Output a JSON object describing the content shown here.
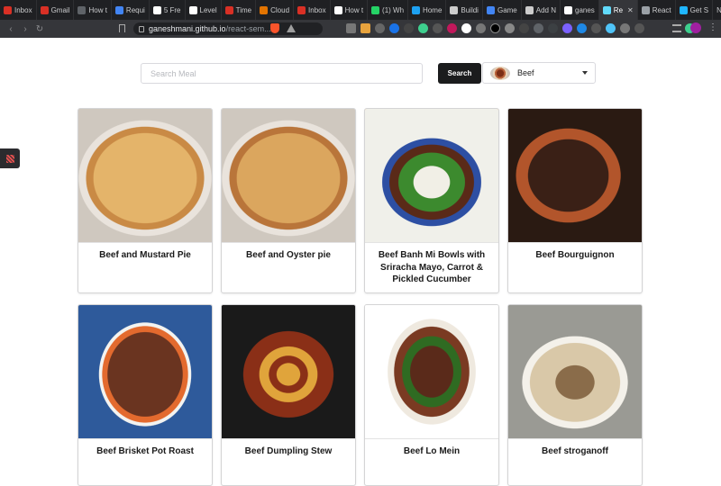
{
  "browser": {
    "tabs": [
      {
        "label": "Inbox",
        "color": "#d93025"
      },
      {
        "label": "Gmail",
        "color": "#d93025"
      },
      {
        "label": "How t",
        "color": "#5f6368"
      },
      {
        "label": "Requi",
        "color": "#4285f4"
      },
      {
        "label": "5 Fre",
        "color": "#ffffff"
      },
      {
        "label": "Level",
        "color": "#ffffff"
      },
      {
        "label": "Time",
        "color": "#d93025"
      },
      {
        "label": "Cloud",
        "color": "#e37400"
      },
      {
        "label": "Inbox",
        "color": "#d93025"
      },
      {
        "label": "How t",
        "color": "#ffffff"
      },
      {
        "label": "(1) Wh",
        "color": "#25d366"
      },
      {
        "label": "Home",
        "color": "#1da1f2"
      },
      {
        "label": "Buildi",
        "color": "#cccccc"
      },
      {
        "label": "Game",
        "color": "#4285f4"
      },
      {
        "label": "Add N",
        "color": "#cccccc"
      },
      {
        "label": "ganes",
        "color": "#ffffff"
      },
      {
        "label": "Re",
        "color": "#61dafb",
        "active": true
      },
      {
        "label": "React",
        "color": "#9aa0a6"
      },
      {
        "label": "Get S",
        "color": "#1fb6ff"
      },
      {
        "label": "New Tab",
        "color": ""
      }
    ],
    "url_host": "ganeshmani.github.io",
    "url_path": "/react-sem..."
  },
  "search": {
    "placeholder": "Search Meal",
    "value": "",
    "button_label": "Search"
  },
  "category": {
    "selected": "Beef"
  },
  "meals": [
    {
      "title": "Beef and Mustard Pie",
      "image": "pie-image",
      "colors": [
        "#c98a45",
        "#e4b46a",
        "#5a2a18"
      ]
    },
    {
      "title": "Beef and Oyster pie",
      "image": "pie-image",
      "colors": [
        "#b9753a",
        "#dba65e",
        "#3c2012"
      ]
    },
    {
      "title": "Beef Banh Mi Bowls with Sriracha Mayo, Carrot & Pickled Cucumber",
      "image": "bowl-image",
      "colors": [
        "#e9a24a",
        "#3c8a2e",
        "#f1efe6"
      ]
    },
    {
      "title": "Beef Bourguignon",
      "image": "stew-image",
      "colors": [
        "#3a2016",
        "#b2552b",
        "#6d3a22"
      ]
    },
    {
      "title": "Beef Brisket Pot Roast",
      "image": "roast-image",
      "colors": [
        "#6a3420",
        "#2e5a9b",
        "#e36a2e"
      ]
    },
    {
      "title": "Beef Dumpling Stew",
      "image": "dumpling-image",
      "colors": [
        "#2b2220",
        "#e0a43b",
        "#8a2f17"
      ]
    },
    {
      "title": "Beef Lo Mein",
      "image": "noodle-image",
      "colors": [
        "#5a2a1a",
        "#2f6b22",
        "#efe9df"
      ]
    },
    {
      "title": "Beef stroganoff",
      "image": "stroganoff-image",
      "colors": [
        "#d9c8a8",
        "#8a6c4a",
        "#e9e4d8"
      ]
    }
  ]
}
